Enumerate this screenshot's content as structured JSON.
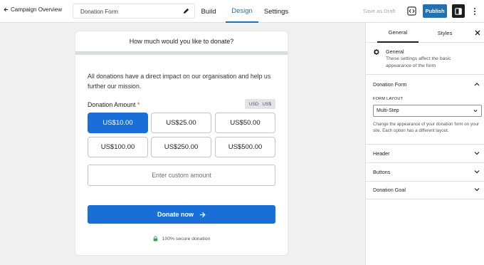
{
  "header": {
    "back_label": "Campaign Overview",
    "form_title": "Donation Form",
    "tabs": [
      "Build",
      "Design",
      "Settings"
    ],
    "active_tab": "Design",
    "save_draft_label": "Save as Draft",
    "publish_label": "Publish",
    "accent_color": "#2271b1"
  },
  "form": {
    "heading": "How much would you like to donate?",
    "description": "All donations have a direct impact on our organisation and help us further our mission.",
    "amount_label": "Donation Amount",
    "required_mark": "*",
    "currency": [
      "USD",
      "US$"
    ],
    "amounts": [
      "US$10.00",
      "US$25.00",
      "US$50.00",
      "US$100.00",
      "US$250.00",
      "US$500.00"
    ],
    "selected_amount": "US$10.00",
    "custom_placeholder": "Enter custom amount",
    "donate_label": "Donate now",
    "secure_label": "100% secure donation",
    "button_color": "#1a6ed8"
  },
  "sidebar": {
    "tabs": [
      "General",
      "Styles"
    ],
    "active_tab": "General",
    "general_title": "General",
    "general_desc": "These settings affect the basic appearance of the form",
    "sections": [
      "Donation Form",
      "Header",
      "Buttons",
      "Donation Goal"
    ],
    "form_layout_label": "FORM LAYOUT",
    "form_layout_value": "Multi-Step",
    "form_layout_help": "Change the appearance of your donation form on your site. Each option has a different layout."
  }
}
